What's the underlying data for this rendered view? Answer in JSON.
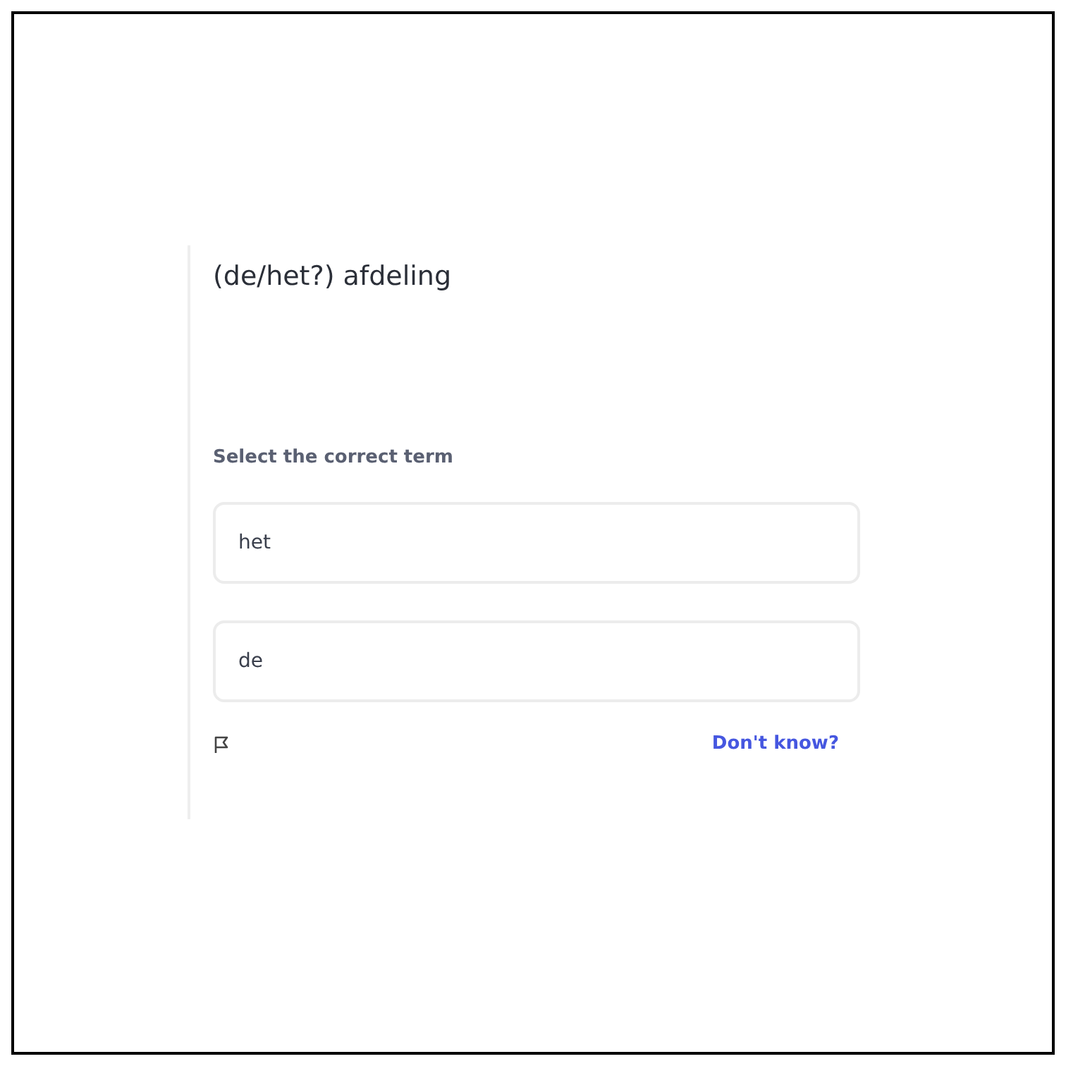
{
  "question": {
    "prompt": "(de/het?) afdeling"
  },
  "instruction": "Select the correct term",
  "options": [
    {
      "label": "het"
    },
    {
      "label": "de"
    }
  ],
  "footer": {
    "link": "Don't know?"
  }
}
